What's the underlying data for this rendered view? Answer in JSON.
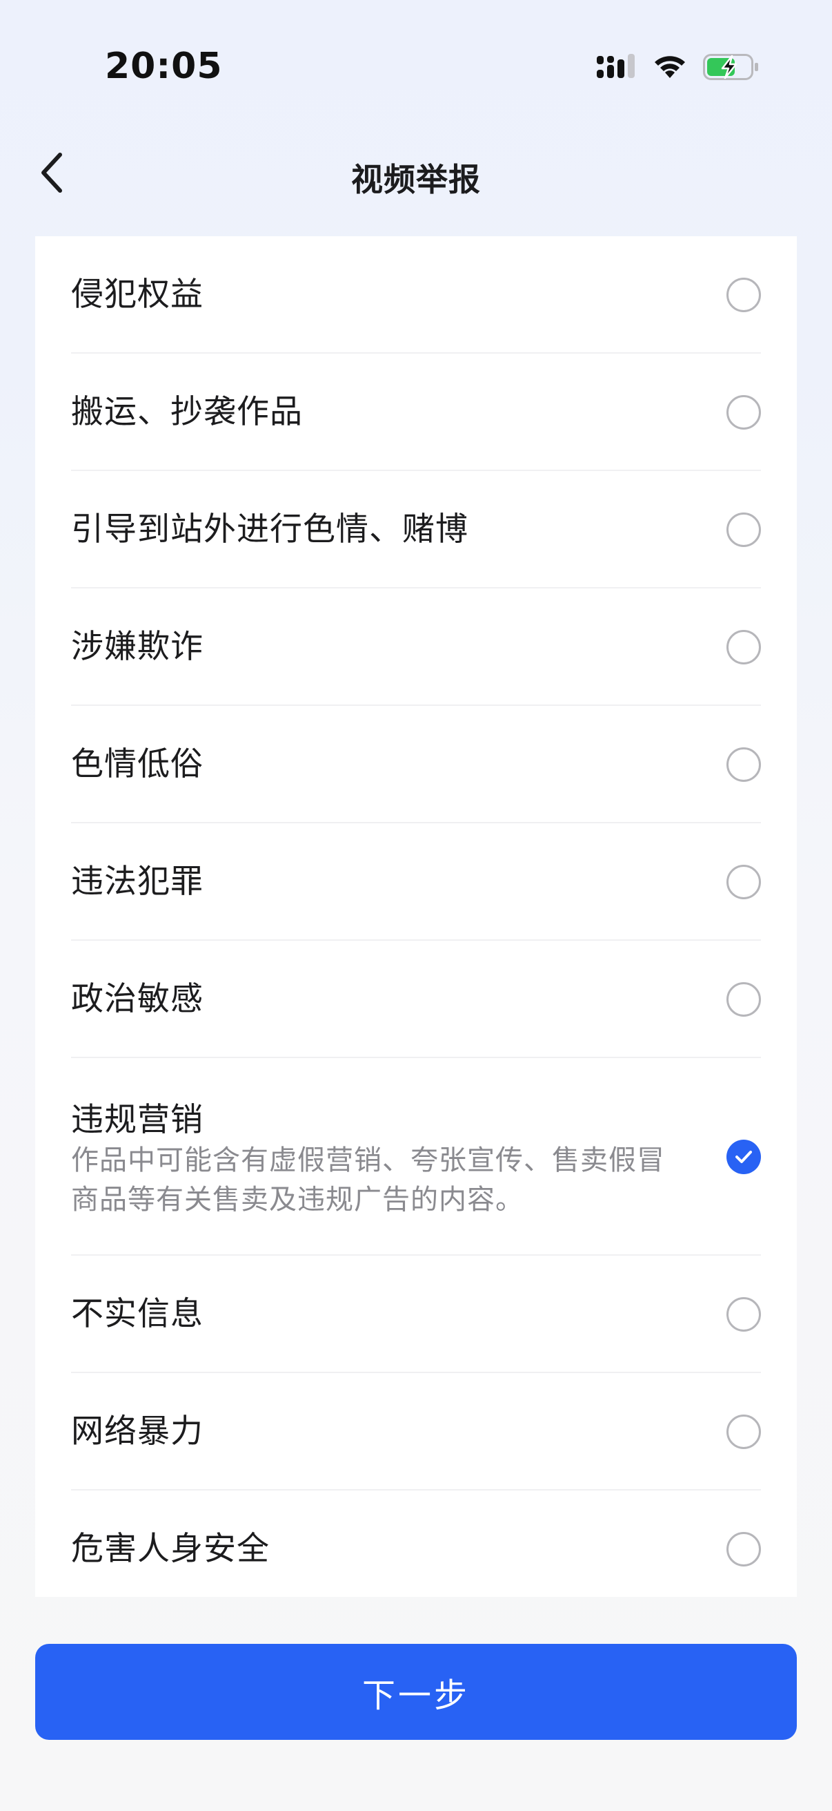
{
  "status_bar": {
    "time": "20:05",
    "icons": [
      "signal-icon",
      "wifi-icon",
      "battery-charging-icon"
    ]
  },
  "header": {
    "title": "视频举报",
    "back_icon": "chevron-left-icon"
  },
  "colors": {
    "accent": "#2862f4",
    "background_top": "#edf1fc",
    "background_bottom": "#f7f7f8",
    "card": "#ffffff",
    "divider": "#f0f0f2",
    "description_text": "#8a8a8f",
    "battery_fill": "#34c759"
  },
  "options": [
    {
      "label": "侵犯权益",
      "selected": false
    },
    {
      "label": "搬运、抄袭作品",
      "selected": false
    },
    {
      "label": "引导到站外进行色情、赌博",
      "selected": false
    },
    {
      "label": "涉嫌欺诈",
      "selected": false
    },
    {
      "label": "色情低俗",
      "selected": false
    },
    {
      "label": "违法犯罪",
      "selected": false
    },
    {
      "label": "政治敏感",
      "selected": false
    },
    {
      "label": "违规营销",
      "description_line1": "作品中可能含有虚假营销、夸张宣传、售卖假冒",
      "description_line2": "商品等有关售卖及违规广告的内容。",
      "selected": true
    },
    {
      "label": "不实信息",
      "selected": false
    },
    {
      "label": "网络暴力",
      "selected": false
    },
    {
      "label": "危害人身安全",
      "selected": false
    }
  ],
  "footer": {
    "next_label": "下一步"
  }
}
